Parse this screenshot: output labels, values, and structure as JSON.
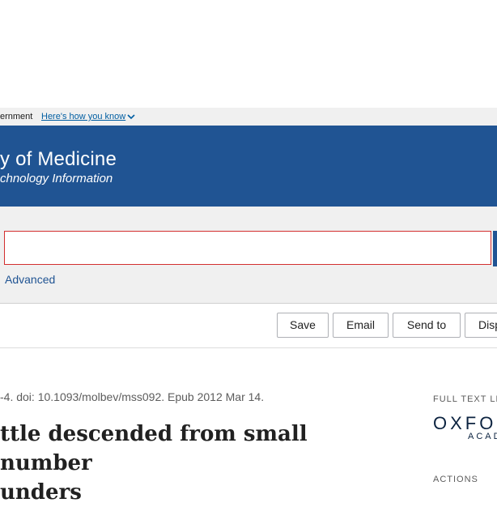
{
  "gov_banner": {
    "text": "ernment",
    "link_label": "Here's how you know"
  },
  "header": {
    "org_name": "y of Medicine",
    "org_subtitle": "chnology Information"
  },
  "search": {
    "value": "",
    "advanced_label": "Advanced"
  },
  "actions": {
    "save_label": "Save",
    "email_label": "Email",
    "send_to_label": "Send to",
    "display_label": "Disp"
  },
  "article": {
    "citation": "-4. doi: 10.1093/molbev/mss092. Epub 2012 Mar 14.",
    "title_line1": "ttle descended from small number",
    "title_line2": "unders"
  },
  "sidebar": {
    "full_text_heading": "FULL TEXT LIN",
    "publisher_main": "OXFO",
    "publisher_sub": "ACAD",
    "actions_heading": "ACTIONS"
  },
  "colors": {
    "header_bg": "#205493",
    "link": "#005ea2",
    "search_border": "#d32f2f"
  }
}
